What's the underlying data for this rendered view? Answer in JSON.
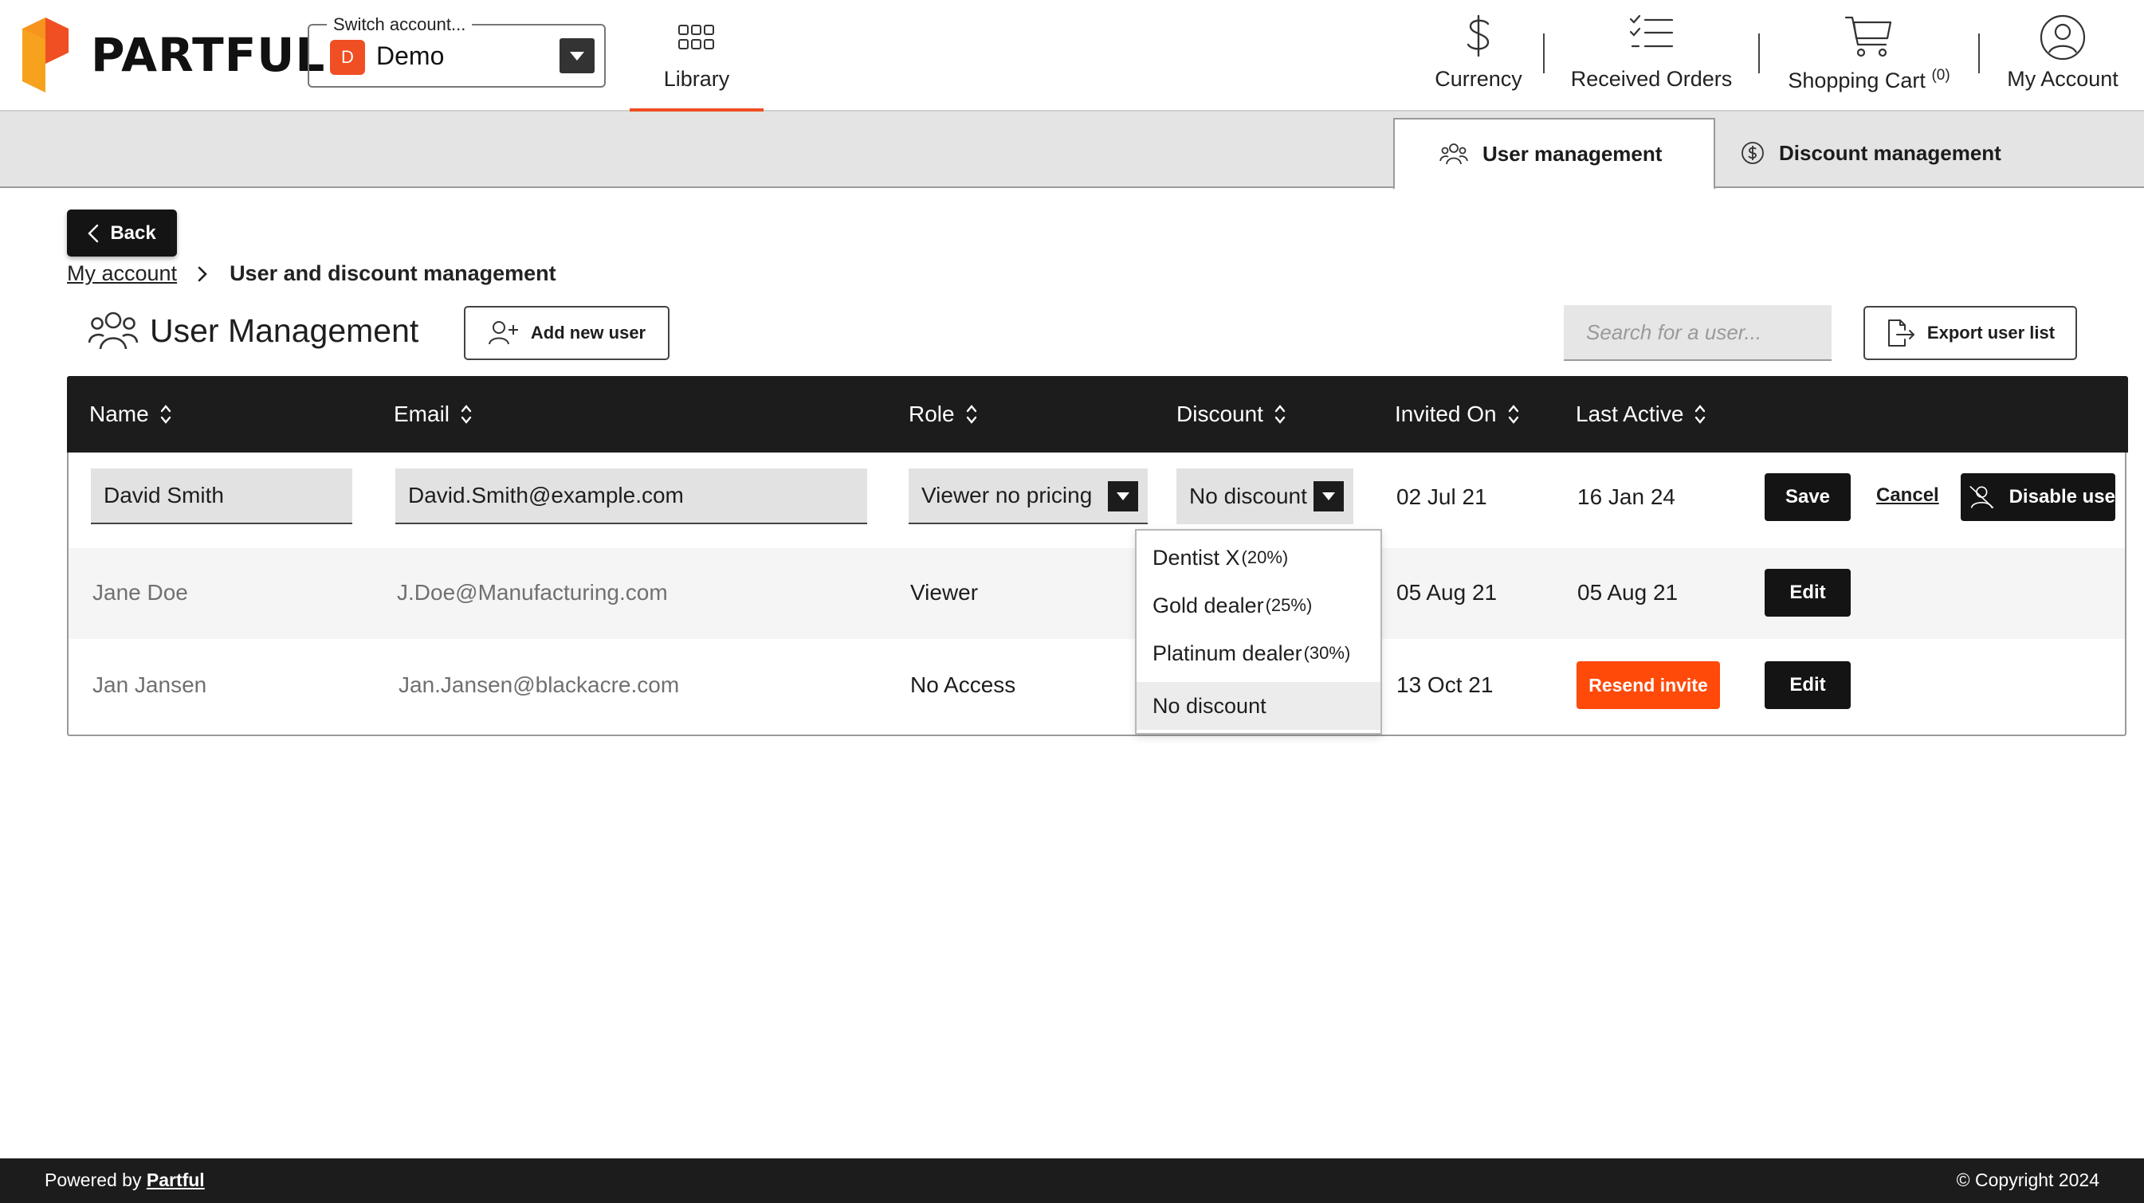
{
  "brand": {
    "name": "PARTFUL",
    "accent": "#F04E23"
  },
  "account_switch": {
    "label": "Switch account...",
    "badge": "D",
    "name": "Demo"
  },
  "nav": {
    "library": "Library",
    "currency": "Currency",
    "received_orders": "Received Orders",
    "shopping_cart": "Shopping Cart",
    "cart_count": "(0)",
    "my_account": "My Account"
  },
  "tabs": [
    {
      "label": "User management",
      "active": true,
      "icon": "users-icon"
    },
    {
      "label": "Discount management",
      "active": false,
      "icon": "dollar-circle-icon"
    }
  ],
  "back_label": "Back",
  "breadcrumb": {
    "parent": "My account",
    "current": "User and discount management"
  },
  "section": {
    "title": "User Management",
    "add_user": "Add new user",
    "search_placeholder": "Search for a user...",
    "export": "Export user list"
  },
  "table": {
    "columns": [
      "Name",
      "Email",
      "Role",
      "Discount",
      "Invited On",
      "Last Active"
    ],
    "editing_row": {
      "name": "David Smith",
      "email": "David.Smith@example.com",
      "role": "Viewer no pricing",
      "discount": "No discount",
      "invited_on": "02 Jul 21",
      "last_active": "16 Jan 24",
      "save": "Save",
      "cancel": "Cancel",
      "disable": "Disable use"
    },
    "rows": [
      {
        "name": "Jane Doe",
        "email": "J.Doe@Manufacturing.com",
        "role": "Viewer",
        "invited_on": "05 Aug 21",
        "last_active": "05 Aug 21",
        "edit": "Edit"
      },
      {
        "name": "Jan Jansen",
        "email": "Jan.Jansen@blackacre.com",
        "role": "No Access",
        "invited_on": "13 Oct 21",
        "last_active": "",
        "resend": "Resend invite",
        "edit": "Edit"
      }
    ]
  },
  "discount_options": [
    {
      "name": "Dentist X",
      "pct": "(20%)"
    },
    {
      "name": "Gold dealer",
      "pct": "(25%)"
    },
    {
      "name": "Platinum dealer",
      "pct": "(30%)"
    },
    {
      "name": "No discount",
      "pct": ""
    }
  ],
  "footer": {
    "powered_prefix": "Powered by",
    "powered_brand": "Partful",
    "copyright": "© Copyright 2024"
  }
}
